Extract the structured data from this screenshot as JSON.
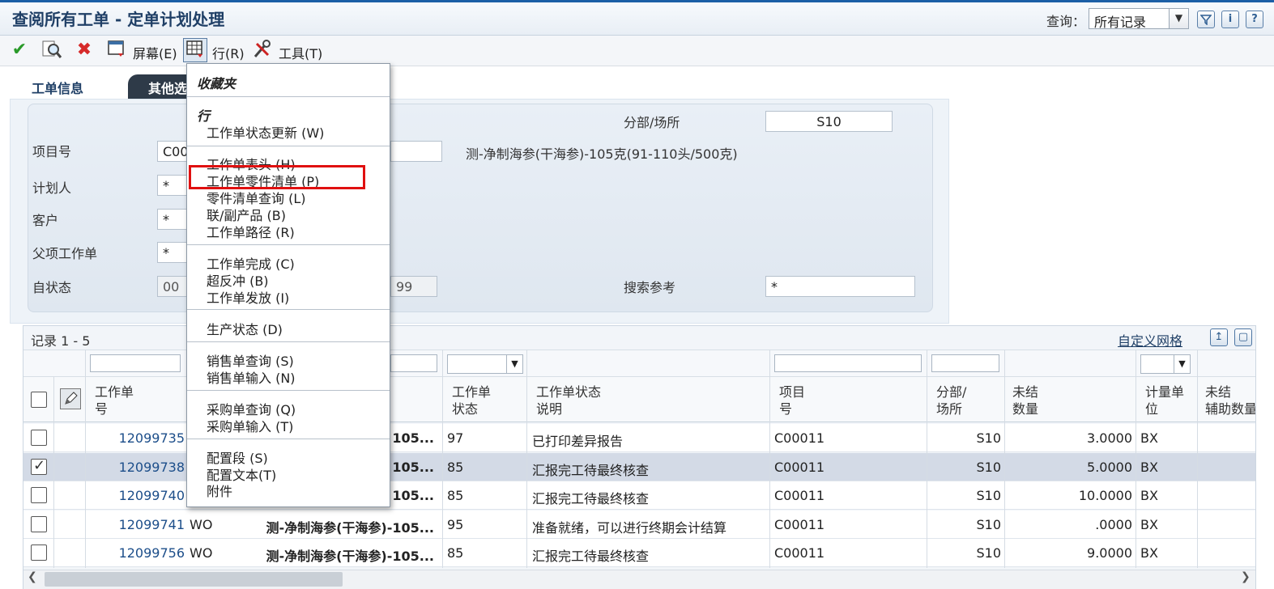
{
  "title": "查阅所有工单 - 定单计划处理",
  "query": {
    "label": "查询：",
    "value": "所有记录"
  },
  "toolbar": {
    "screen_label": "屏幕(E)",
    "row_label": "行(R)",
    "tools_label": "工具(T)"
  },
  "tabs": [
    {
      "label": "工单信息"
    },
    {
      "label": "其他选"
    }
  ],
  "form": {
    "item_label": "项目号",
    "item_value": "C00",
    "item_desc": "测-净制海参(干海参)-105克(91-110头/500克)",
    "planner_label": "计划人",
    "planner_value": "*",
    "customer_label": "客户",
    "customer_value": "*",
    "parent_label": "父项工作单",
    "parent_value": "*",
    "status_label": "自状态",
    "status_from": "00",
    "status_to": "99",
    "branch_label": "分部/场所",
    "branch_value": "S10",
    "search_ref_label": "搜索参考",
    "search_ref_value": "*"
  },
  "grid": {
    "records": "记录 1 - 5",
    "custom_grid": "自定义网格",
    "headers": {
      "wo_no": [
        "工作单",
        "号"
      ],
      "wo_status": [
        "工作单",
        "状态"
      ],
      "wo_status_desc": [
        "工作单状态",
        "说明"
      ],
      "item_no": [
        "项目",
        "号"
      ],
      "branch": [
        "分部/",
        "场所"
      ],
      "open_qty": [
        "未结",
        "数量"
      ],
      "uom": [
        "计量单",
        "位"
      ],
      "open_sec_qty": [
        "未结",
        "辅助数量"
      ]
    },
    "rows": [
      {
        "checked": false,
        "wo": "12099735",
        "type": "",
        "desc": "105...",
        "status": "97",
        "status_desc": "已打印差异报告",
        "item": "C00011",
        "branch": "S10",
        "qty": "3.0000",
        "uom": "BX"
      },
      {
        "checked": true,
        "wo": "12099738",
        "type": "",
        "desc": "105...",
        "status": "85",
        "status_desc": "汇报完工待最终核查",
        "item": "C00011",
        "branch": "S10",
        "qty": "5.0000",
        "uom": "BX"
      },
      {
        "checked": false,
        "wo": "12099740",
        "type": "",
        "desc": "105...",
        "status": "85",
        "status_desc": "汇报完工待最终核查",
        "item": "C00011",
        "branch": "S10",
        "qty": "10.0000",
        "uom": "BX"
      },
      {
        "checked": false,
        "wo": "12099741",
        "type": "WO",
        "desc": "测-净制海参(干海参)-105...",
        "status": "95",
        "status_desc": "准备就绪，可以进行终期会计结算",
        "item": "C00011",
        "branch": "S10",
        "qty": ".0000",
        "uom": "BX"
      },
      {
        "checked": false,
        "wo": "12099756",
        "type": "WO",
        "desc": "测-净制海参(干海参)-105...",
        "status": "85",
        "status_desc": "汇报完工待最终核查",
        "item": "C00011",
        "branch": "S10",
        "qty": "9.0000",
        "uom": "BX"
      }
    ]
  },
  "menu": {
    "favorites": "收藏夹",
    "row_heading": "行",
    "items": [
      "工作单状态更新 (W)",
      "工作单表头 (H)",
      "工作单零件清单 (P)",
      "零件清单查询 (L)",
      "联/副产品 (B)",
      "工作单路径 (R)",
      "工作单完成 (C)",
      "超反冲 (B)",
      "工作单发放 (I)",
      "生产状态 (D)",
      "销售单查询 (S)",
      "销售单输入 (N)",
      "采购单查询 (Q)",
      "采购单输入 (T)",
      "配置段 (S)",
      "配置文本(T)",
      "附件"
    ]
  },
  "colors": {
    "accent": "#1f3f66",
    "highlight": "#e01010",
    "selected_row": "#d3dae6"
  }
}
